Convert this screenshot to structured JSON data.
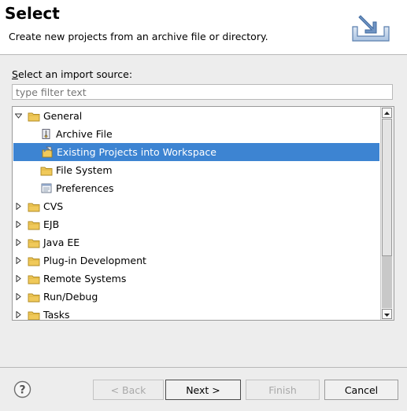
{
  "header": {
    "title": "Select",
    "description": "Create new projects from an archive file or directory."
  },
  "source": {
    "label_mnemonic": "S",
    "label_rest": "elect an import source:",
    "filter_placeholder": "type filter text"
  },
  "tree": {
    "items": [
      {
        "label": "General",
        "level": 0,
        "expanded": true,
        "icon": "folder-icon"
      },
      {
        "label": "Archive File",
        "level": 1,
        "icon": "archive-icon"
      },
      {
        "label": "Existing Projects into Workspace",
        "level": 1,
        "icon": "project-import-icon",
        "selected": true
      },
      {
        "label": "File System",
        "level": 1,
        "icon": "folder-icon"
      },
      {
        "label": "Preferences",
        "level": 1,
        "icon": "preferences-icon"
      },
      {
        "label": "CVS",
        "level": 0,
        "expanded": false,
        "icon": "folder-icon"
      },
      {
        "label": "EJB",
        "level": 0,
        "expanded": false,
        "icon": "folder-icon"
      },
      {
        "label": "Java EE",
        "level": 0,
        "expanded": false,
        "icon": "folder-icon"
      },
      {
        "label": "Plug-in Development",
        "level": 0,
        "expanded": false,
        "icon": "folder-icon"
      },
      {
        "label": "Remote Systems",
        "level": 0,
        "expanded": false,
        "icon": "folder-icon"
      },
      {
        "label": "Run/Debug",
        "level": 0,
        "expanded": false,
        "icon": "folder-icon"
      },
      {
        "label": "Tasks",
        "level": 0,
        "expanded": false,
        "icon": "folder-icon"
      }
    ]
  },
  "buttons": {
    "back": "< Back",
    "next": "Next >",
    "finish": "Finish",
    "cancel": "Cancel"
  },
  "colors": {
    "selection": "#3d84d2",
    "folder": "#f0c95a"
  }
}
